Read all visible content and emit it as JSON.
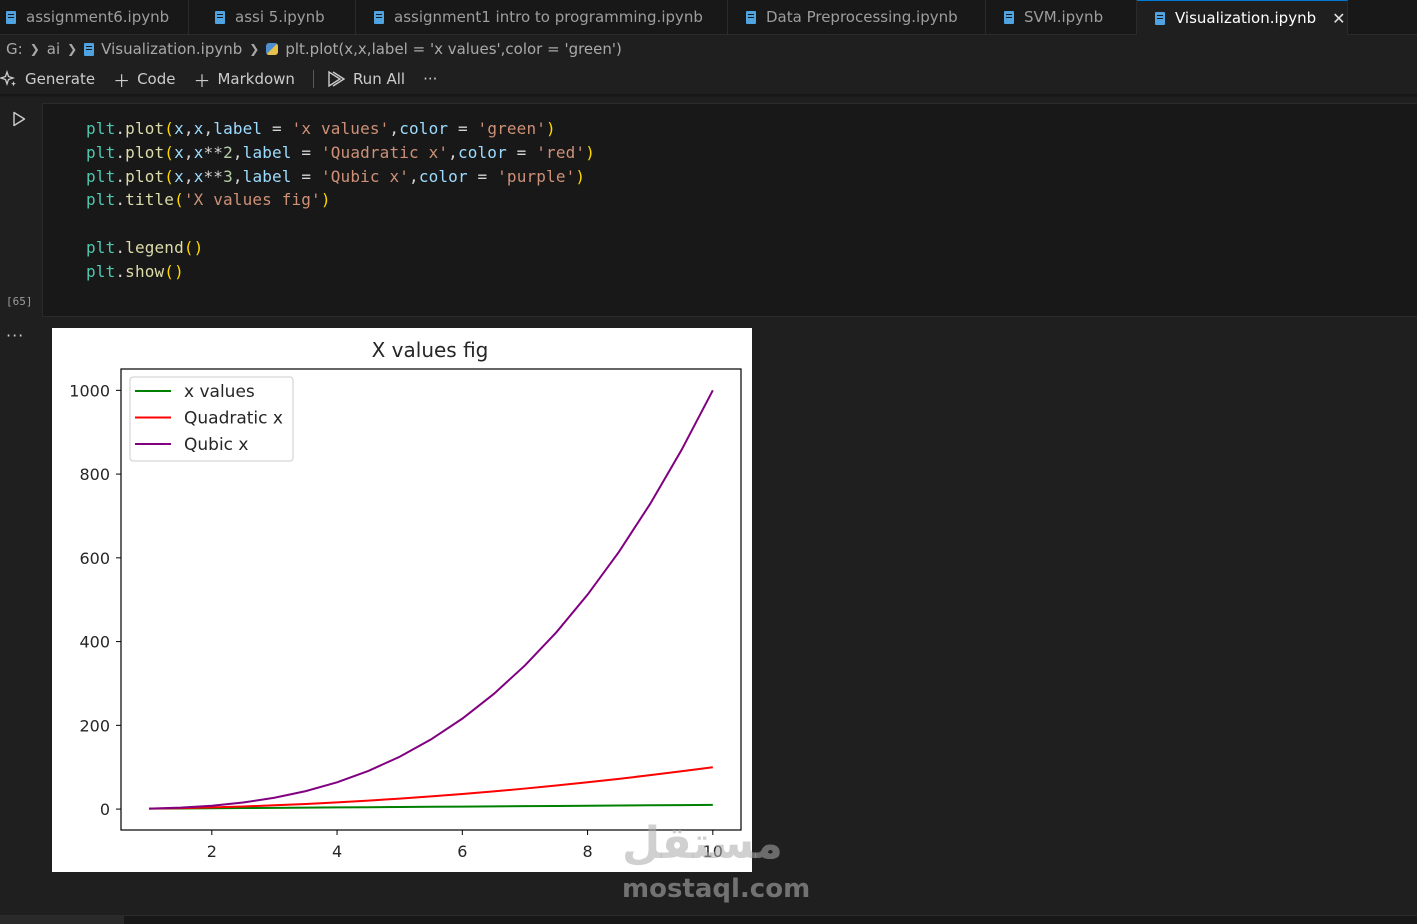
{
  "tabs": [
    {
      "label": "assignment6.ipynb",
      "active": false
    },
    {
      "label": "assi 5.ipynb",
      "active": false
    },
    {
      "label": "assignment1 intro to programming.ipynb",
      "active": false
    },
    {
      "label": "Data Preprocessing.ipynb",
      "active": false
    },
    {
      "label": "SVM.ipynb",
      "active": false
    },
    {
      "label": "Visualization.ipynb",
      "active": true
    }
  ],
  "breadcrumb": {
    "drive": "G:",
    "folder": "ai",
    "file": "Visualization.ipynb",
    "symbol": "plt.plot(x,x,label = 'x values',color = 'green')"
  },
  "toolbar": {
    "generate": "Generate",
    "code": "Code",
    "markdown": "Markdown",
    "run_all": "Run All",
    "more": "···"
  },
  "cell": {
    "execution_count": "[65]",
    "lines": [
      "plt.plot(x,x,label = 'x values',color = 'green')",
      "plt.plot(x,x**2,label = 'Quadratic x',color = 'red')",
      "plt.plot(x,x**3,label = 'Qubic x',color = 'purple')",
      "plt.title('X values fig')",
      "",
      "plt.legend()",
      "plt.show()"
    ]
  },
  "output": {
    "more": "···"
  },
  "chart_data": {
    "type": "line",
    "title": "X values fig",
    "xlabel": "",
    "ylabel": "",
    "xlim": [
      0.55,
      10.45
    ],
    "ylim": [
      -49.95,
      1050.95
    ],
    "xticks": [
      2,
      4,
      6,
      8,
      10
    ],
    "yticks": [
      0,
      200,
      400,
      600,
      800,
      1000
    ],
    "legend_position": "upper-left",
    "grid": false,
    "series": [
      {
        "name": "x values",
        "color": "#008000",
        "x": [
          1,
          1.5,
          2,
          2.5,
          3,
          3.5,
          4,
          4.5,
          5,
          5.5,
          6,
          6.5,
          7,
          7.5,
          8,
          8.5,
          9,
          9.5,
          10
        ],
        "y": [
          1,
          1.5,
          2,
          2.5,
          3,
          3.5,
          4,
          4.5,
          5,
          5.5,
          6,
          6.5,
          7,
          7.5,
          8,
          8.5,
          9,
          9.5,
          10
        ]
      },
      {
        "name": "Quadratic x",
        "color": "#ff0000",
        "x": [
          1,
          1.5,
          2,
          2.5,
          3,
          3.5,
          4,
          4.5,
          5,
          5.5,
          6,
          6.5,
          7,
          7.5,
          8,
          8.5,
          9,
          9.5,
          10
        ],
        "y": [
          1,
          2.25,
          4,
          6.25,
          9,
          12.25,
          16,
          20.25,
          25,
          30.25,
          36,
          42.25,
          49,
          56.25,
          64,
          72.25,
          81,
          90.25,
          100
        ]
      },
      {
        "name": "Qubic x",
        "color": "#800080",
        "x": [
          1,
          1.5,
          2,
          2.5,
          3,
          3.5,
          4,
          4.5,
          5,
          5.5,
          6,
          6.5,
          7,
          7.5,
          8,
          8.5,
          9,
          9.5,
          10
        ],
        "y": [
          1,
          3.375,
          8,
          15.625,
          27,
          42.875,
          64,
          91.125,
          125,
          166.375,
          216,
          274.625,
          343,
          421.875,
          512,
          614.125,
          729,
          857.375,
          1000
        ]
      }
    ]
  },
  "watermark": {
    "arabic": "مستقل",
    "latin": "mostaql.com"
  }
}
